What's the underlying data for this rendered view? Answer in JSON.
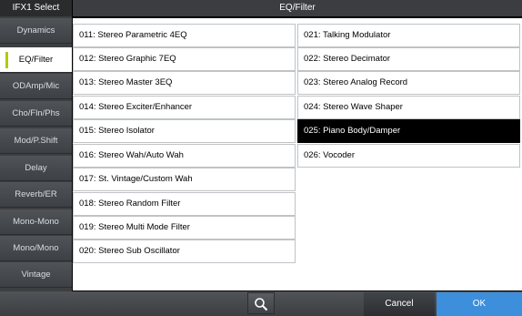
{
  "header": {
    "left_title": "IFX1 Select",
    "main_title": "EQ/Filter"
  },
  "sidebar": {
    "categories": [
      {
        "label": "Dynamics",
        "selected": false
      },
      {
        "label": "EQ/Filter",
        "selected": true
      },
      {
        "label": "ODAmp/Mic",
        "selected": false
      },
      {
        "label": "Cho/Fln/Phs",
        "selected": false
      },
      {
        "label": "Mod/P.Shift",
        "selected": false
      },
      {
        "label": "Delay",
        "selected": false
      },
      {
        "label": "Reverb/ER",
        "selected": false
      },
      {
        "label": "Mono-Mono",
        "selected": false
      },
      {
        "label": "Mono/Mono",
        "selected": false
      },
      {
        "label": "Vintage",
        "selected": false
      }
    ]
  },
  "list": {
    "column1": [
      "011: Stereo Parametric 4EQ",
      "012: Stereo Graphic 7EQ",
      "013: Stereo Master 3EQ",
      "014: Stereo Exciter/Enhancer",
      "015: Stereo Isolator",
      "016: Stereo Wah/Auto Wah",
      "017: St. Vintage/Custom Wah",
      "018: Stereo Random Filter",
      "019: Stereo Multi Mode Filter",
      "020: Stereo Sub Oscillator"
    ],
    "column2": [
      "021: Talking Modulator",
      "022: Stereo Decimator",
      "023: Stereo Analog Record",
      "024: Stereo Wave Shaper",
      "025: Piano Body/Damper",
      "026: Vocoder"
    ],
    "selected": "025: Piano Body/Damper"
  },
  "footer": {
    "search_icon": "search-icon",
    "cancel_label": "Cancel",
    "ok_label": "OK"
  },
  "colors": {
    "accent": "#3d8fdc",
    "active_marker": "#b5c800",
    "selected_bg": "#000000"
  }
}
